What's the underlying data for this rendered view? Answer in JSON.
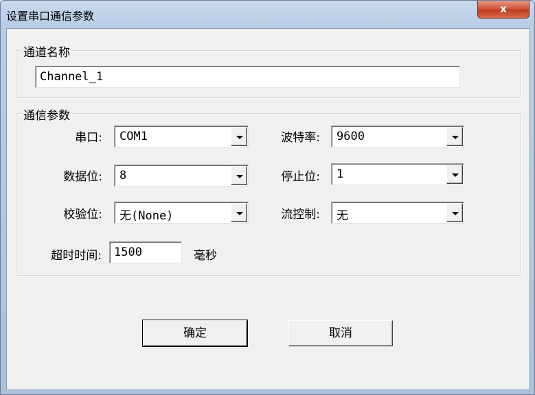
{
  "window": {
    "title": "设置串口通信参数",
    "close_glyph": "x"
  },
  "channel_group": {
    "legend": "通道名称",
    "name_value": "Channel_1"
  },
  "comm_group": {
    "legend": "通信参数",
    "port_label": "串口:",
    "port_value": "COM1",
    "baud_label": "波特率:",
    "baud_value": "9600",
    "databits_label": "数据位:",
    "databits_value": "8",
    "stopbits_label": "停止位:",
    "stopbits_value": "1",
    "parity_label": "校验位:",
    "parity_value": "无(None)",
    "flow_label": "流控制:",
    "flow_value": "无",
    "timeout_label": "超时时间:",
    "timeout_value": "1500",
    "timeout_unit": "毫秒"
  },
  "buttons": {
    "ok_label": "确定",
    "cancel_label": "取消"
  },
  "icons": {
    "dropdown": "chevron-down-icon",
    "close": "close-icon"
  }
}
